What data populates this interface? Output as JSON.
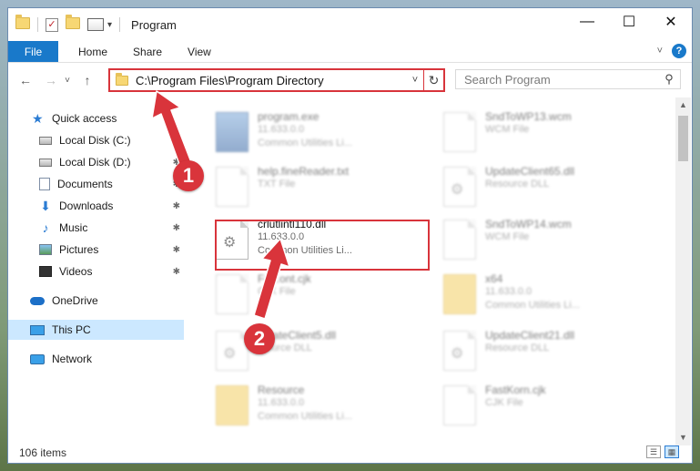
{
  "window": {
    "title": "Program",
    "controls": {
      "minimize": "—",
      "maximize": "☐",
      "close": "✕"
    }
  },
  "ribbon": {
    "file_tab": "File",
    "tabs": [
      "Home",
      "Share",
      "View"
    ],
    "expand": "˅",
    "help": "?"
  },
  "nav": {
    "back": "←",
    "forward": "→",
    "recent": "˅",
    "up": "↑",
    "address": "C:\\Program Files\\Program Directory",
    "address_chevron": "˅",
    "refresh": "↻",
    "search_placeholder": "Search Program",
    "search_icon": "⚲"
  },
  "sidebar": {
    "items": [
      {
        "label": "Quick access",
        "icon": "star-icon"
      },
      {
        "label": "Local Disk (C:)",
        "icon": "drive-icon",
        "pin": "✱"
      },
      {
        "label": "Local Disk (D:)",
        "icon": "drive-icon",
        "pin": "✱"
      },
      {
        "label": "Documents",
        "icon": "documents-icon",
        "pin": "✱"
      },
      {
        "label": "Downloads",
        "icon": "download-icon",
        "pin": "✱"
      },
      {
        "label": "Music",
        "icon": "music-icon",
        "pin": "✱"
      },
      {
        "label": "Pictures",
        "icon": "pictures-icon",
        "pin": "✱"
      },
      {
        "label": "Videos",
        "icon": "videos-icon",
        "pin": "✱"
      },
      {
        "label": "OneDrive",
        "icon": "onedrive-icon"
      },
      {
        "label": "This PC",
        "icon": "this-pc-icon"
      },
      {
        "label": "Network",
        "icon": "network-icon"
      }
    ]
  },
  "files": [
    {
      "name": "program.exe",
      "line1": "11.633.0.0",
      "line2": "Common Utilities Li..."
    },
    {
      "name": "SndToWP13.wcm",
      "line1": "WCM File",
      "line2": ""
    },
    {
      "name": "help.fineReader.txt",
      "line1": "TXT File",
      "line2": ""
    },
    {
      "name": "UpdateClient65.dll",
      "line1": "Resource DLL",
      "line2": ""
    },
    {
      "name": "crlutlintl110.dll",
      "line1": "11.633.0.0",
      "line2": "Common Utilities Li..."
    },
    {
      "name": "SndToWP14.wcm",
      "line1": "WCM File",
      "line2": ""
    },
    {
      "name": "Fa...ont.cjk",
      "line1": "CJK File",
      "line2": ""
    },
    {
      "name": "x64",
      "line1": "11.633.0.0",
      "line2": "Common Utilities Li..."
    },
    {
      "name": "...dateClient5.dll",
      "line1": "...ource DLL",
      "line2": ""
    },
    {
      "name": "UpdateClient21.dll",
      "line1": "Resource DLL",
      "line2": ""
    },
    {
      "name": "Resource",
      "line1": "11.633.0.0",
      "line2": "Common Utilities Li..."
    },
    {
      "name": "FastKorn.cjk",
      "line1": "CJK File",
      "line2": ""
    }
  ],
  "status": {
    "count": "106 items"
  },
  "callouts": {
    "step1": "1",
    "step2": "2"
  },
  "colors": {
    "accent": "#1979ca",
    "highlight": "#d8343b",
    "selection": "#cce8ff"
  }
}
